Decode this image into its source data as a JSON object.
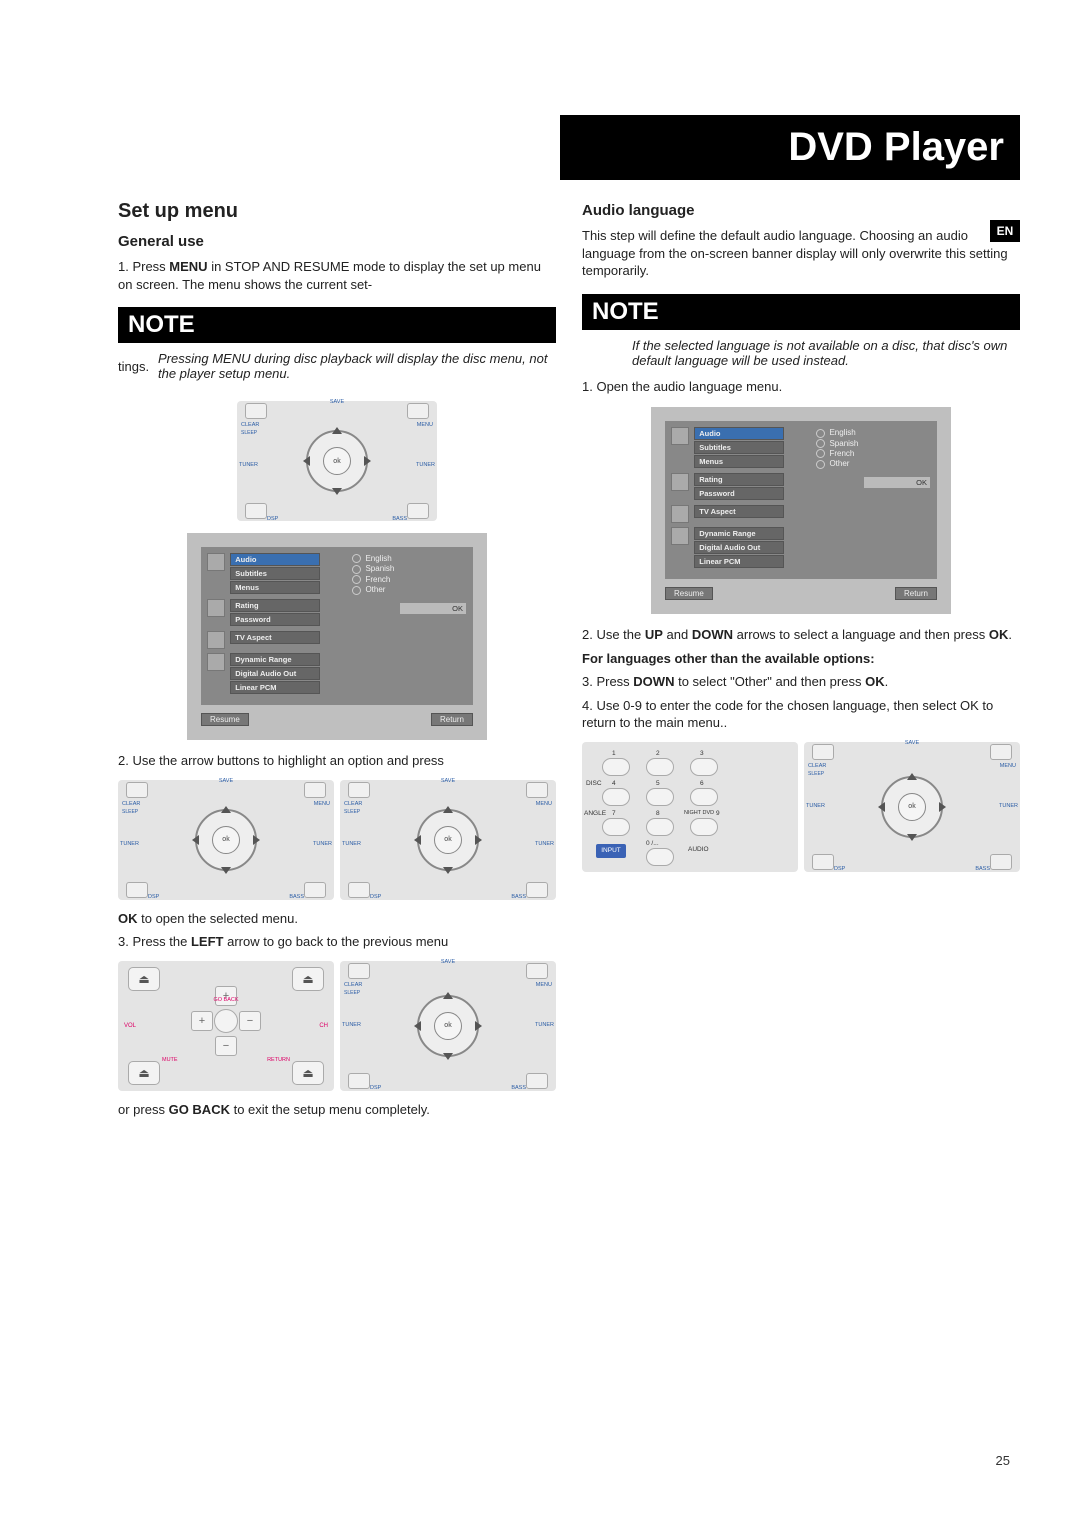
{
  "page_number": "25",
  "lang_badge": "EN",
  "title": "DVD Player",
  "leftCol": {
    "h2": "Set up menu",
    "h3": "General use",
    "step1_a": "1. Press ",
    "step1_b": "MENU",
    "step1_c": " in STOP AND RESUME mode to display the set up menu on screen. The menu shows the current set-",
    "note_label": "NOTE",
    "tings": "tings.",
    "note_text": "Pressing MENU during disc playback will display the disc menu, not the player setup menu.",
    "step2": "2. Use the arrow buttons to highlight an option and press",
    "ok_line_a": "OK",
    "ok_line_b": " to open the selected menu.",
    "step3_a": "3.  Press the ",
    "step3_b": "LEFT",
    "step3_c": " arrow to go back to the previous menu",
    "goback_a": "or press ",
    "goback_b": "GO BACK",
    "goback_c": " to exit the setup menu completely."
  },
  "rightCol": {
    "h3": "Audio language",
    "intro": "This step will define the default audio language. Choosing an audio language from the on-screen banner display will only overwrite this setting temporarily.",
    "note_label": "NOTE",
    "note_text": "If the selected language is not available on a disc, that disc's own default language will be used instead.",
    "step1": "1. Open the audio language menu.",
    "step2_a": "2. Use the ",
    "step2_b": "UP",
    "step2_c": " and ",
    "step2_d": "DOWN",
    "step2_e": " arrows to select a language and then press ",
    "step2_f": "OK",
    "step2_g": ".",
    "sub_bold": "For languages other than the available options:",
    "step3_a": "3. Press ",
    "step3_b": "DOWN",
    "step3_c": " to select \"Other\" and then press ",
    "step3_d": "OK",
    "step3_e": ".",
    "step4": "4. Use 0-9 to enter the code for the chosen language, then select OK to return to the main menu.."
  },
  "remote": {
    "clear": "CLEAR",
    "sleep": "SLEEP",
    "menu": "MENU",
    "save": "SAVE",
    "tuner": "TUNER",
    "dsp": "DSP",
    "bass": "BASS",
    "ok": "ok"
  },
  "setup": {
    "groups": {
      "g1": [
        "Audio",
        "Subtitles",
        "Menus"
      ],
      "g2": [
        "Rating",
        "Password"
      ],
      "g3": [
        "TV Aspect"
      ],
      "g4": [
        "Dynamic Range",
        "Digital Audio Out",
        "Linear PCM"
      ]
    },
    "opts": [
      "English",
      "Spanish",
      "French",
      "Other"
    ],
    "ok": "OK",
    "resume": "Resume",
    "return": "Return"
  },
  "goback_fig": {
    "vol": "VOL",
    "ch": "CH",
    "mute": "MUTE",
    "return": "RETURN",
    "goback": "GO BACK"
  },
  "numpad": {
    "disc": "DISC",
    "angle": "ANGLE",
    "night": "NIGHT DVD",
    "audio": "AUDIO",
    "input": "INPUT",
    "n1": "1",
    "n2": "2",
    "n3": "3",
    "n4": "4",
    "n5": "5",
    "n6": "6",
    "n7": "7",
    "n8": "8",
    "n9": "9",
    "n0": "0 /..."
  }
}
